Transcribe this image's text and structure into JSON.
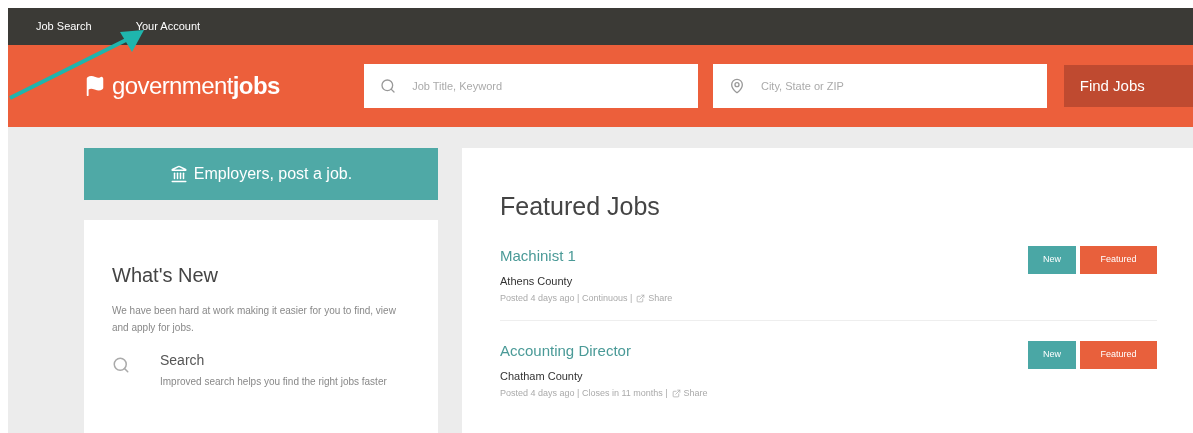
{
  "top_nav": [
    {
      "label": "Job Search"
    },
    {
      "label": "Your Account"
    }
  ],
  "header": {
    "logo": "government**jobs**",
    "keyword_search": {
      "placeholder": "Job Title, Keyword"
    },
    "location_search": {
      "placeholder": "City, State or ZIP"
    },
    "find_button": "Find Jobs"
  },
  "employers_button": "Employers, post a job.",
  "whats_new": {
    "title": "What's New",
    "intro": "We have been hard at work making it easier for you to find, view and apply for jobs.",
    "features": [
      {
        "title": "Search",
        "description": "Improved search helps you find the right jobs faster"
      }
    ]
  },
  "featured": {
    "title": "Featured Jobs",
    "jobs": [
      {
        "title": "Machinist 1",
        "location": "Athens County",
        "meta": "Posted 4 days ago | Continuous |",
        "share": "Share",
        "badges": [
          {
            "label": "New",
            "kind": "new"
          },
          {
            "label": "Featured",
            "kind": "featured"
          }
        ]
      },
      {
        "title": "Accounting Director",
        "location": "Chatham County",
        "meta": "Posted 4 days ago | Closes in 11 months |",
        "share": "Share",
        "badges": [
          {
            "label": "New",
            "kind": "new"
          },
          {
            "label": "Featured",
            "kind": "featured"
          }
        ]
      }
    ]
  }
}
